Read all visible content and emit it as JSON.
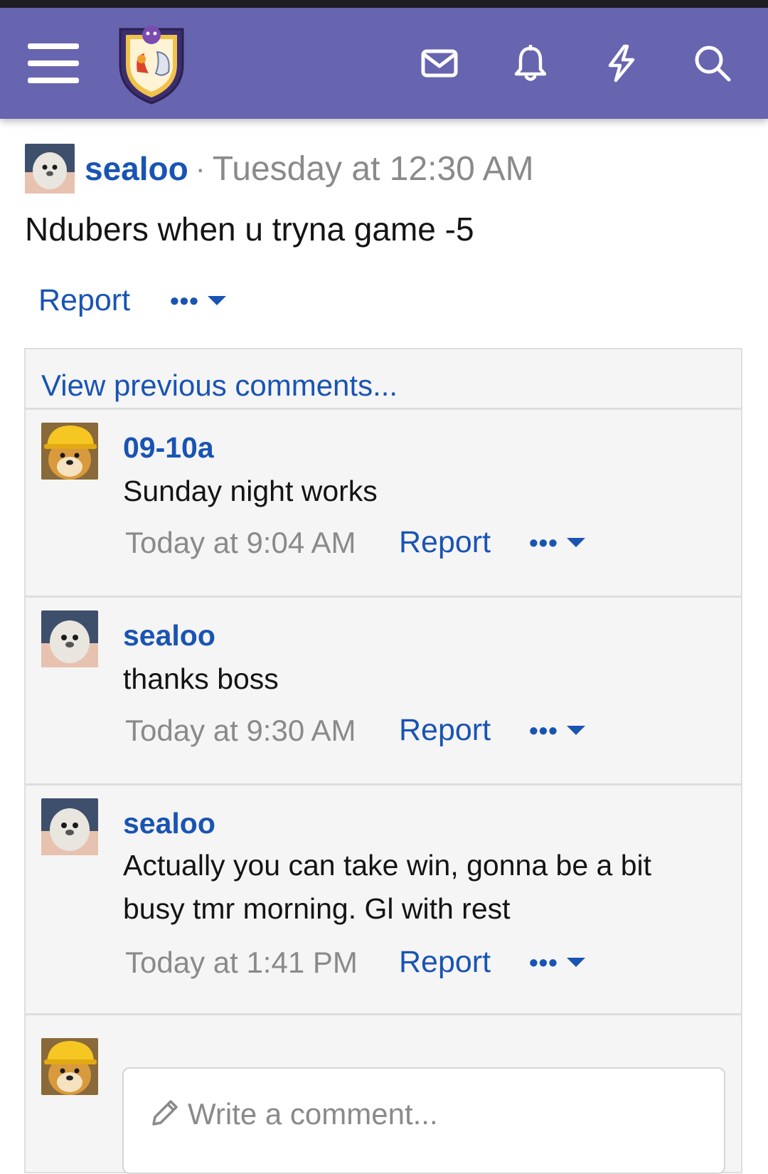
{
  "navbar": {
    "icons": [
      "menu-icon",
      "site-logo",
      "mail-icon",
      "bell-icon",
      "bolt-icon",
      "search-icon"
    ],
    "color": "#6765b0"
  },
  "post": {
    "author": "sealoo",
    "separator": "·",
    "time": "Tuesday at 12:30 AM",
    "body": "Ndubers when u tryna game -5",
    "report_label": "Report",
    "more_label": "•••"
  },
  "comments": {
    "view_previous": "View previous comments...",
    "items": [
      {
        "author": "09-10a",
        "text": "Sunday night works",
        "time": "Today at 9:04 AM",
        "report_label": "Report",
        "more_label": "•••"
      },
      {
        "author": "sealoo",
        "text": "thanks boss",
        "time": "Today at 9:30 AM",
        "report_label": "Report",
        "more_label": "•••"
      },
      {
        "author": "sealoo",
        "text": "Actually you can take win, gonna be a bit busy tmr morning. Gl with rest",
        "time": "Today at 1:41 PM",
        "report_label": "Report",
        "more_label": "•••"
      }
    ],
    "write_placeholder": "Write a comment..."
  },
  "colors": {
    "link": "#1954b3",
    "muted": "#8a8a8a",
    "panel": "#f5f5f5"
  }
}
